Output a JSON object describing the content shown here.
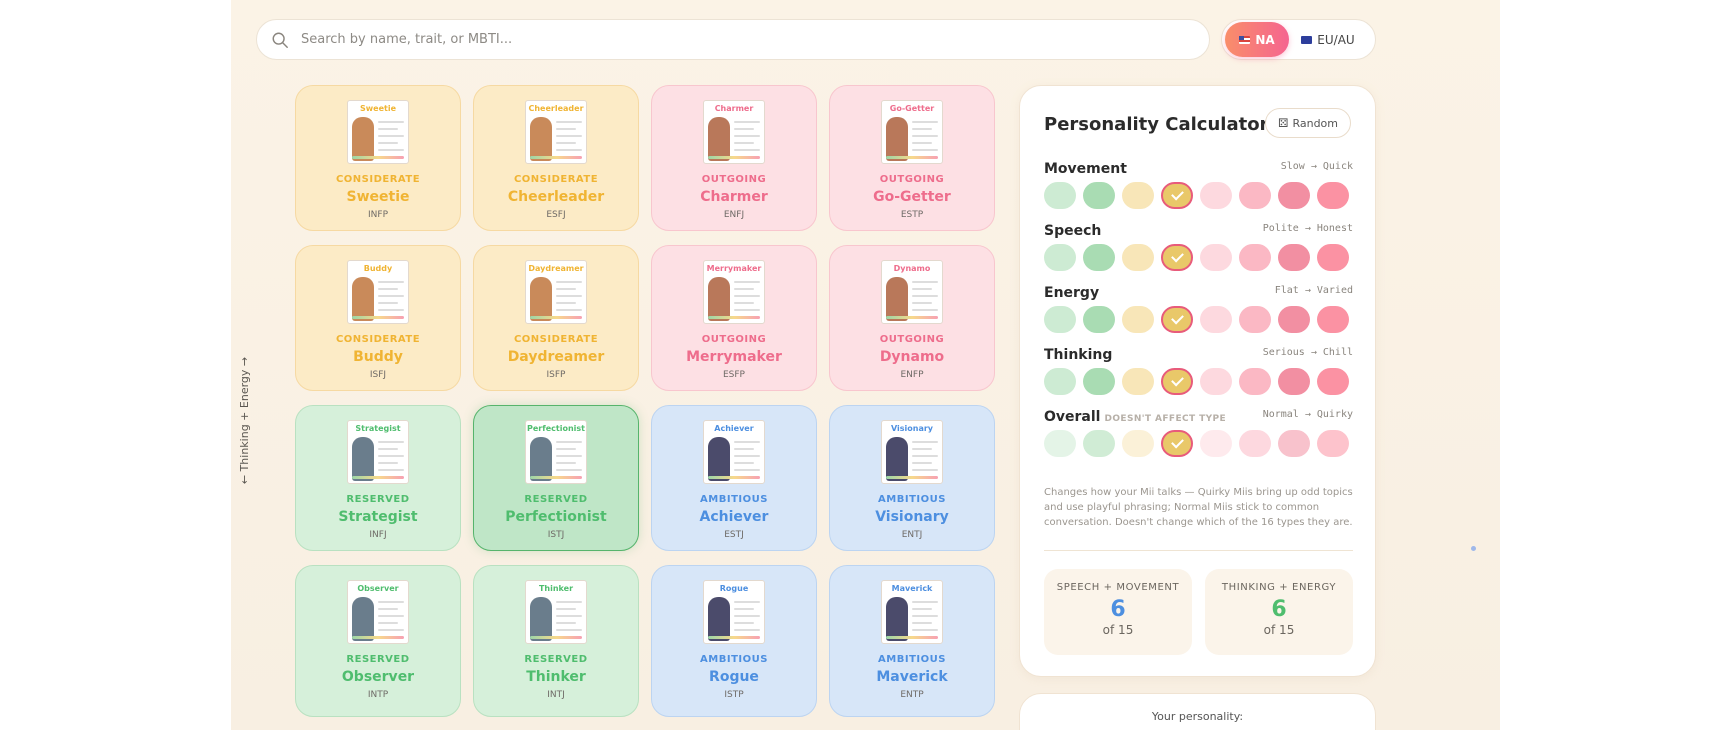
{
  "search": {
    "placeholder": "Search by name, trait, or MBTI..."
  },
  "region": {
    "options": [
      {
        "label": "NA",
        "active": true,
        "flag": "us-flag"
      },
      {
        "label": "EU/AU",
        "active": false,
        "flag": "eu-flag"
      }
    ]
  },
  "axis": {
    "vertical_label": "← Thinking + Energy →"
  },
  "cards": [
    {
      "name": "Sweetie",
      "category": "CONSIDERATE",
      "mbti": "INFP",
      "theme": "yellow"
    },
    {
      "name": "Cheerleader",
      "category": "CONSIDERATE",
      "mbti": "ESFJ",
      "theme": "yellow"
    },
    {
      "name": "Charmer",
      "category": "OUTGOING",
      "mbti": "ENFJ",
      "theme": "pink"
    },
    {
      "name": "Go-Getter",
      "category": "OUTGOING",
      "mbti": "ESTP",
      "theme": "pink"
    },
    {
      "name": "Buddy",
      "category": "CONSIDERATE",
      "mbti": "ISFJ",
      "theme": "yellow"
    },
    {
      "name": "Daydreamer",
      "category": "CONSIDERATE",
      "mbti": "ISFP",
      "theme": "yellow"
    },
    {
      "name": "Merrymaker",
      "category": "OUTGOING",
      "mbti": "ESFP",
      "theme": "pink"
    },
    {
      "name": "Dynamo",
      "category": "OUTGOING",
      "mbti": "ENFP",
      "theme": "pink"
    },
    {
      "name": "Strategist",
      "category": "RESERVED",
      "mbti": "INFJ",
      "theme": "green"
    },
    {
      "name": "Perfectionist",
      "category": "RESERVED",
      "mbti": "ISTJ",
      "theme": "green",
      "selected": true
    },
    {
      "name": "Achiever",
      "category": "AMBITIOUS",
      "mbti": "ESTJ",
      "theme": "blue"
    },
    {
      "name": "Visionary",
      "category": "AMBITIOUS",
      "mbti": "ENTJ",
      "theme": "blue"
    },
    {
      "name": "Observer",
      "category": "RESERVED",
      "mbti": "INTP",
      "theme": "green"
    },
    {
      "name": "Thinker",
      "category": "RESERVED",
      "mbti": "INTJ",
      "theme": "green"
    },
    {
      "name": "Rogue",
      "category": "AMBITIOUS",
      "mbti": "ISTP",
      "theme": "blue"
    },
    {
      "name": "Maverick",
      "category": "AMBITIOUS",
      "mbti": "ENTP",
      "theme": "blue"
    }
  ],
  "calculator": {
    "title": "Personality Calculator",
    "random_label": "Random",
    "dot_colors": [
      "#cdebd3",
      "#a9dcb3",
      "#f8e6b8",
      "#e9c869",
      "#fdd9df",
      "#fbb8c4",
      "#f28fa2",
      "#fb92a3"
    ],
    "sliders": [
      {
        "label": "Movement",
        "range": "Slow → Quick",
        "selected": 4
      },
      {
        "label": "Speech",
        "range": "Polite → Honest",
        "selected": 4
      },
      {
        "label": "Energy",
        "range": "Flat → Varied",
        "selected": 4
      },
      {
        "label": "Thinking",
        "range": "Serious → Chill",
        "selected": 4
      },
      {
        "label": "Overall",
        "sub": "DOESN'T AFFECT TYPE",
        "range": "Normal → Quirky",
        "selected": 4
      }
    ],
    "overall_note": "Changes how your Mii talks — Quirky Miis bring up odd topics and use playful phrasing; Normal Miis stick to common conversation. Doesn't change which of the 16 types they are.",
    "stats": [
      {
        "label": "SPEECH + MOVEMENT",
        "value": "6",
        "of": "of 15",
        "color": "#4d8fe0"
      },
      {
        "label": "THINKING + ENERGY",
        "value": "6",
        "of": "of 15",
        "color": "#4fbd6e"
      }
    ]
  },
  "result": {
    "label": "Your personality:"
  }
}
